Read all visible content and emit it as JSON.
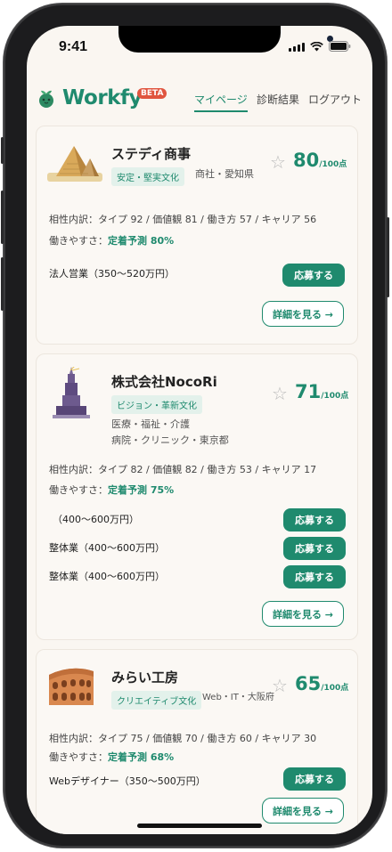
{
  "status": {
    "time": "9:41"
  },
  "app": {
    "logo": "Workfy",
    "beta": "BETA"
  },
  "nav": {
    "mypage": "マイページ",
    "results": "診断結果",
    "logout": "ログアウト"
  },
  "cards": [
    {
      "name": "ステディ商事",
      "tag": "安定・堅実文化",
      "meta1": "商社・愛知県",
      "score": "80",
      "score_unit": "/100点",
      "breakdown": "相性内訳：タイプ 92 / 価値観 81 / 働き方 57 / キャリア 56",
      "ease_label": "働きやすさ：",
      "ease_value": "定着予測 80%",
      "jobs": [
        "法人営業（350〜520万円）"
      ],
      "apply": "応募する",
      "detail": "詳細を見る →"
    },
    {
      "name": "株式会社NocoRi",
      "tag": "ビジョン・革新文化",
      "meta1": "医療・福祉・介護",
      "meta2": "病院・クリニック・東京都",
      "score": "71",
      "score_unit": "/100点",
      "breakdown": "相性内訳：タイプ 82 / 価値観 82 / 働き方 53 / キャリア 17",
      "ease_label": "働きやすさ：",
      "ease_value": "定着予測 75%",
      "jobs": [
        "（400〜600万円）",
        "整体業（400〜600万円）",
        "整体業（400〜600万円）"
      ],
      "apply": "応募する",
      "detail": "詳細を見る →"
    },
    {
      "name": "みらい工房",
      "tag": "クリエイティブ文化",
      "meta1": "Web・IT・大阪府",
      "score": "65",
      "score_unit": "/100点",
      "breakdown": "相性内訳：タイプ 75 / 価値観 70 / 働き方 60 / キャリア 30",
      "ease_label": "働きやすさ：",
      "ease_value": "定着予測 68%",
      "jobs": [
        "Webデザイナー（350〜500万円）"
      ],
      "apply": "応募する",
      "detail": "詳細を見る →"
    }
  ],
  "colors": {
    "accent": "#1f8a6e",
    "beta": "#e0553f",
    "background": "#faf6f1"
  }
}
